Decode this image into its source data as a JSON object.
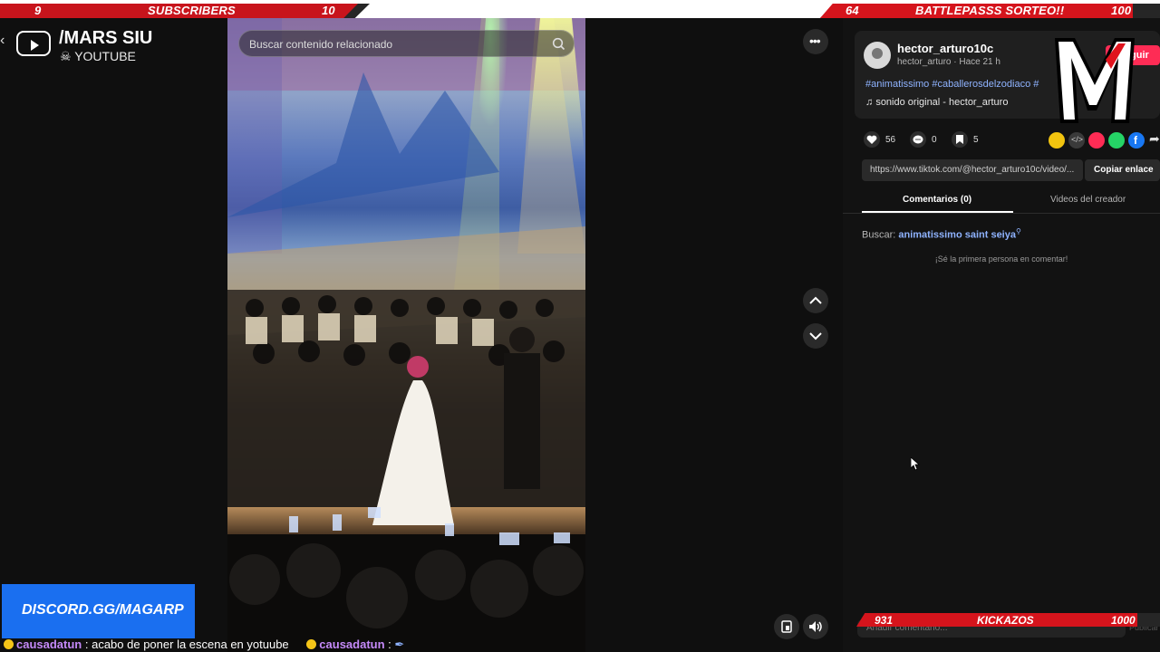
{
  "goals": {
    "left": {
      "current": "9",
      "label": "SUBSCRIBERS",
      "target": "10",
      "progress": 0.9
    },
    "right": {
      "current": "64",
      "label": "BATTLEPASSS SORTEO!!",
      "target": "100",
      "progress": 0.64
    }
  },
  "channel": {
    "name": "/MARS SIU",
    "platform": "YOUTUBE"
  },
  "search": {
    "placeholder": "Buscar contenido relacionado"
  },
  "post": {
    "username": "hector_arturo10c",
    "meta": "hector_arturo · Hace 21 h",
    "follow_label": "guir",
    "hashtags": "#animatissimo #caballerosdelzodiaco #",
    "sound": "sonido original - hector_arturo",
    "likes": "56",
    "comments": "0",
    "saves": "5",
    "url": "https://www.tiktok.com/@hector_arturo10c/video/...",
    "copy_label": "Copiar enlace"
  },
  "tabs": [
    {
      "label": "Comentarios (0)",
      "active": true
    },
    {
      "label": "Videos del creador",
      "active": false
    }
  ],
  "comments": {
    "search_prefix": "Buscar:",
    "search_term": "animatissimo saint seiya",
    "empty": "¡Sé la primera persona en comentar!",
    "input_placeholder": "Añadir comentario...",
    "post_label": "Publicar"
  },
  "overlay": {
    "discord": "DISCORD.GG/MAGARP",
    "logo_letter": "M",
    "kick_goal": {
      "current": "931",
      "label": "KICKAZOS",
      "target": "1000",
      "progress": 0.931
    }
  },
  "chat": [
    {
      "user": "causadatun",
      "message": ": acabo de poner la escena en yotuube"
    },
    {
      "user": "causadatun",
      "message": ":"
    }
  ],
  "colors": {
    "accent": "#fe2c55",
    "goal_red": "#d5141c",
    "discord_blue": "#1a6ff0",
    "link": "#8fb3ff"
  }
}
